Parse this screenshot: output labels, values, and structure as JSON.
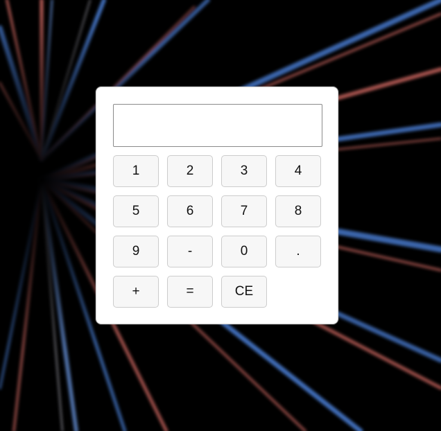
{
  "calculator": {
    "display_value": "",
    "keys": [
      "1",
      "2",
      "3",
      "4",
      "5",
      "6",
      "7",
      "8",
      "9",
      "-",
      "0",
      ".",
      "+",
      "=",
      "CE"
    ]
  },
  "colors": {
    "background": "#000000",
    "panel": "#ffffff",
    "key_fill": "#f7f7f7",
    "key_border": "#cccccc",
    "streak_blue": "#4a7fd6",
    "streak_red": "#e0706a"
  }
}
